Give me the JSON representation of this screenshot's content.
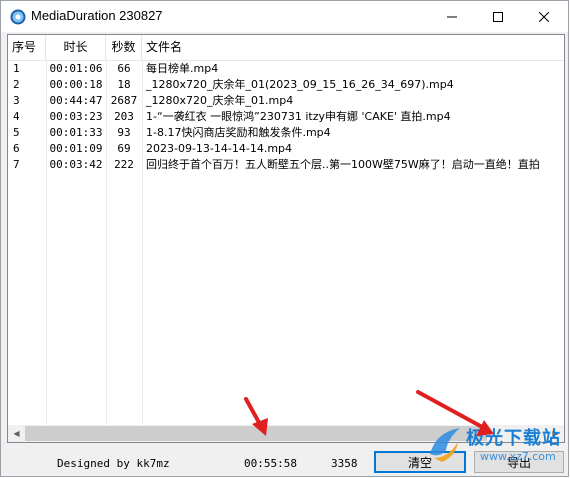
{
  "window": {
    "title": "MediaDuration 230827"
  },
  "list": {
    "headers": [
      "序号",
      "时长",
      "秒数",
      "文件名"
    ],
    "rows": [
      {
        "no": "1",
        "time": "00:01:06",
        "sec": "66",
        "name": "每日榜单.mp4"
      },
      {
        "no": "2",
        "time": "00:00:18",
        "sec": "18",
        "name": "_1280x720_庆余年_01(2023_09_15_16_26_34_697).mp4"
      },
      {
        "no": "3",
        "time": "00:44:47",
        "sec": "2687",
        "name": "_1280x720_庆余年_01.mp4"
      },
      {
        "no": "4",
        "time": "00:03:23",
        "sec": "203",
        "name": "1-“一袭红衣 一眼惊鸿”230731 itzy申有娜 'CAKE' 直拍.mp4"
      },
      {
        "no": "5",
        "time": "00:01:33",
        "sec": "93",
        "name": "1-8.17快闪商店奖励和触发条件.mp4"
      },
      {
        "no": "6",
        "time": "00:01:09",
        "sec": "69",
        "name": "2023-09-13-14-14-14.mp4"
      },
      {
        "no": "7",
        "time": "00:03:42",
        "sec": "222",
        "name": "回归终于首个百万！五人断壁五个层..第一100W壁75W麻了！启动一直绝！直拍"
      }
    ]
  },
  "status": {
    "credit": "Designed by kk7mz",
    "total_time": "00:55:58",
    "total_seconds": "3358"
  },
  "buttons": {
    "clear": "清空",
    "export": "导出"
  },
  "watermark": {
    "text": "极光下载站",
    "url": "www.xz7.com"
  },
  "colors": {
    "accent": "#0078d7",
    "annotation_arrow": "#e02020",
    "watermark": "#1a7fd4"
  }
}
